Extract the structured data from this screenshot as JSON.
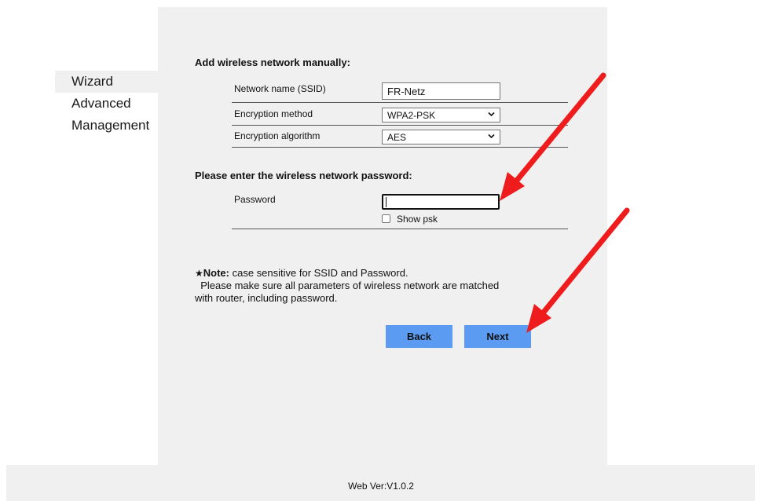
{
  "sidebar": {
    "items": [
      {
        "label": "Wizard",
        "active": true
      },
      {
        "label": "Advanced",
        "active": false
      },
      {
        "label": "Management",
        "active": false
      }
    ]
  },
  "manual": {
    "title": "Add wireless network manually:",
    "ssid_label": "Network name (SSID)",
    "ssid_value": "FR-Netz",
    "encryption_method_label": "Encryption method",
    "encryption_method_value": "WPA2-PSK",
    "encryption_algorithm_label": "Encryption algorithm",
    "encryption_algorithm_value": "AES"
  },
  "password_section": {
    "title": "Please enter the wireless network password:",
    "password_label": "Password",
    "password_value": "",
    "show_psk_label": "Show psk",
    "show_psk_checked": false
  },
  "note": {
    "star": "★",
    "heading": "Note:",
    "line1": " case sensitive for SSID and Password.",
    "line2": "Please make sure all parameters of wireless network are matched",
    "line3": "with router,  including password."
  },
  "buttons": {
    "back": "Back",
    "next": "Next"
  },
  "footer": {
    "version": "Web Ver:V1.0.2"
  },
  "colors": {
    "button": "#5b9cf2",
    "panel": "#f0f0f0",
    "annotation_arrow": "#ee1c1c"
  }
}
